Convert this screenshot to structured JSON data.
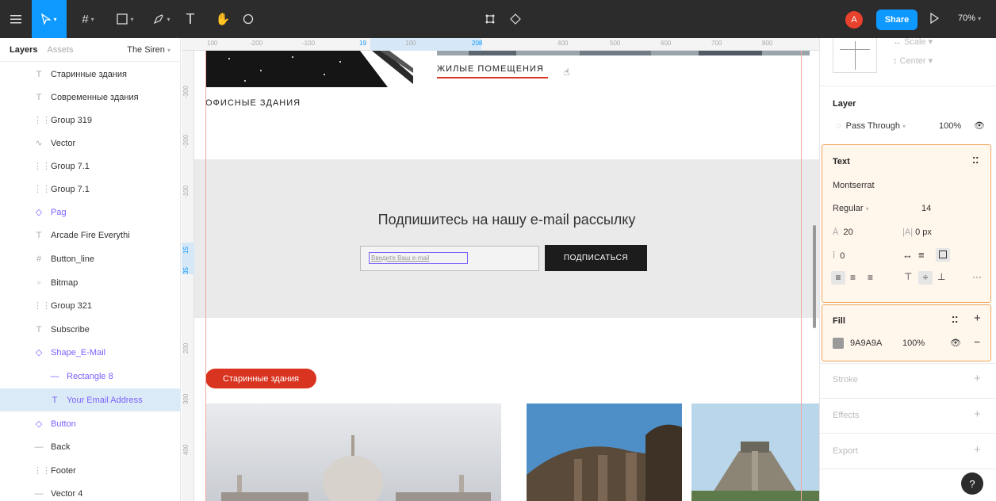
{
  "toolbar": {
    "avatar_letter": "A",
    "share_label": "Share",
    "zoom": "70%"
  },
  "left_panel": {
    "tabs": {
      "layers": "Layers",
      "assets": "Assets"
    },
    "page_name": "The Siren",
    "layers": [
      {
        "name": "Старинные здания",
        "icon": "text-icon"
      },
      {
        "name": "Современные здания",
        "icon": "text-icon"
      },
      {
        "name": "Group 319",
        "icon": "group-icon"
      },
      {
        "name": "Vector",
        "icon": "vector-icon"
      },
      {
        "name": "Group 7.1",
        "icon": "group-icon"
      },
      {
        "name": "Group 7.1",
        "icon": "group-icon"
      },
      {
        "name": "Pag",
        "icon": "component-icon"
      },
      {
        "name": "Arcade Fire Everythi",
        "icon": "text-icon"
      },
      {
        "name": "Button_line",
        "icon": "frame-icon"
      },
      {
        "name": "Bitmap",
        "icon": "image-icon"
      },
      {
        "name": "Group 321",
        "icon": "group-icon"
      },
      {
        "name": "Subscribe",
        "icon": "text-icon"
      },
      {
        "name": "Shape_E-Mail",
        "icon": "component-icon"
      },
      {
        "name": "Rectangle 8",
        "icon": "line-icon"
      },
      {
        "name": "Your Email Address",
        "icon": "text-icon"
      },
      {
        "name": "Button",
        "icon": "component-icon"
      },
      {
        "name": "Back",
        "icon": "line-icon"
      },
      {
        "name": "Footer",
        "icon": "group-icon"
      },
      {
        "name": "Vector 4",
        "icon": "line-icon"
      }
    ]
  },
  "ruler_top": [
    "100",
    "-200",
    "-100",
    "19",
    "100",
    "208",
    "400",
    "500",
    "600",
    "700",
    "800"
  ],
  "ruler_left": [
    "-300",
    "-200",
    "-100",
    "15",
    "35",
    "200",
    "300",
    "400"
  ],
  "canvas": {
    "nav_office": "ОФИСНЫЕ ЗДАНИЯ",
    "nav_residential": "ЖИЛЫЕ ПОМЕЩЕНИЯ",
    "subscribe_heading": "Подпишитесь на нашу e-mail рассылку",
    "email_placeholder": "Введите Ваш e-mail",
    "subscribe_button": "ПОДПИСАТЬСЯ",
    "tag_old_buildings": "Старинные здания"
  },
  "right_panel": {
    "constraints": {
      "horizontal": "Scale",
      "vertical": "Center"
    },
    "layer": {
      "title": "Layer",
      "blend": "Pass Through",
      "opacity": "100%"
    },
    "text": {
      "title": "Text",
      "font": "Montserrat",
      "weight": "Regular",
      "size": "14",
      "line_height": "20",
      "letter_spacing": "0 px",
      "paragraph_spacing": "0"
    },
    "fill": {
      "title": "Fill",
      "hex": "9A9A9A",
      "opacity": "100%",
      "swatch": "#9a9a9a"
    },
    "stroke": "Stroke",
    "effects": "Effects",
    "export": "Export",
    "help": "?"
  },
  "colors": {
    "accent": "#0d99ff",
    "tag_red": "#d8341f",
    "selection": "#daebf7",
    "highlight": "#f0a45a"
  }
}
